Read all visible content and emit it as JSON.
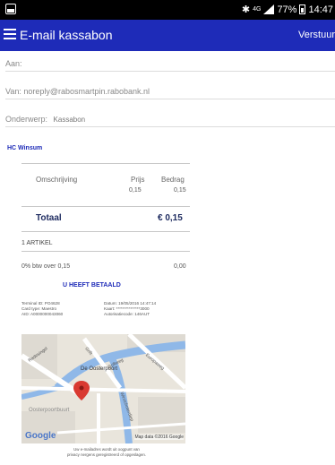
{
  "statusbar": {
    "network": "4G",
    "battery": "77%",
    "time": "14:47"
  },
  "toolbar": {
    "title": "E-mail kassabon",
    "send_label": "Verstuur"
  },
  "form": {
    "to_label": "Aan:",
    "from_text": "Van: noreply@rabosmartpin.rabobank.nl",
    "subject_label": "Onderwerp:",
    "subject_value": "Kassabon"
  },
  "receipt": {
    "merchant": "HC Winsum",
    "columns": {
      "description": "Omschrijving",
      "price": "Prijs",
      "amount": "Bedrag"
    },
    "line_price": "0,15",
    "line_amount": "0,15",
    "total_label": "Totaal",
    "total_value": "€ 0,15",
    "items_count": "1 ARTIKEL",
    "vat_label": "0% btw over 0,15",
    "vat_value": "0,00",
    "paid_label": "U HEEFT BETAALD",
    "details_left": [
      "Terminal ID: PO4628",
      "Card type: Maestro",
      "AID: A0000000043060"
    ],
    "details_right": [
      "Datum: 19/05/2016 14:47:14",
      "Kaart: ***************3000",
      "Autorisatiecode: 146AUT"
    ]
  },
  "map": {
    "poi": "De Oosterpoort",
    "streets": [
      "Radesingel",
      "Oosterpoortbuurt",
      "Griftweg",
      "Europaweg",
      "Winschoterdiep",
      "Grift"
    ],
    "brand": "Google",
    "copyright": "Map data ©2016 Google"
  },
  "footer": {
    "line1": "Uw e-mailadres wordt uit oogpunt van",
    "line2": "privacy nergens geregistreerd of opgeslagen."
  },
  "colors": {
    "toolbar": "#1e2bb8",
    "accent": "#1e2bb8",
    "pin": "#d93a31"
  }
}
